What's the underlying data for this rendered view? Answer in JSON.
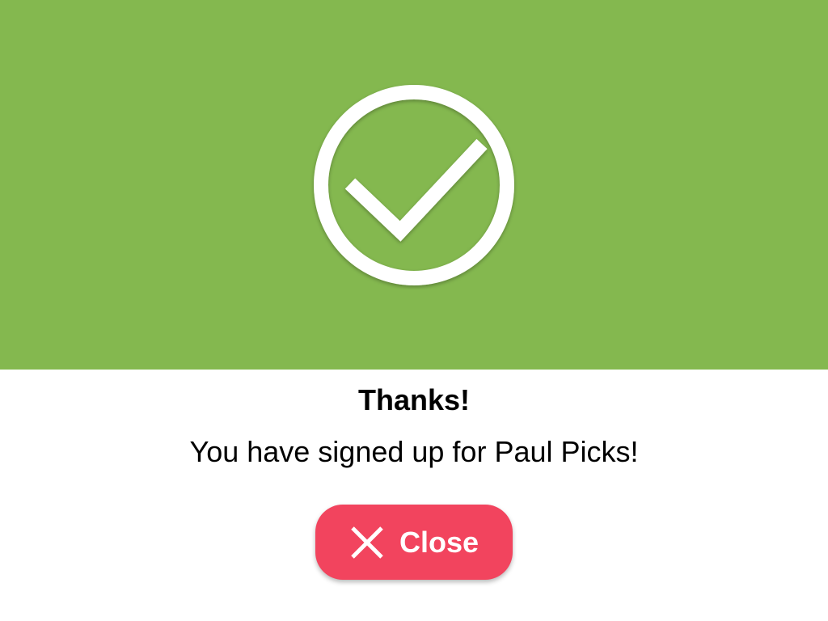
{
  "colors": {
    "banner": "#84b84f",
    "close_button": "#f2445e",
    "icon": "#ffffff"
  },
  "banner": {
    "icon": "checkmark-circle-icon"
  },
  "dialog": {
    "title": "Thanks!",
    "message": "You have signed up for Paul Picks!"
  },
  "close_button": {
    "icon": "close-icon",
    "label": "Close"
  }
}
